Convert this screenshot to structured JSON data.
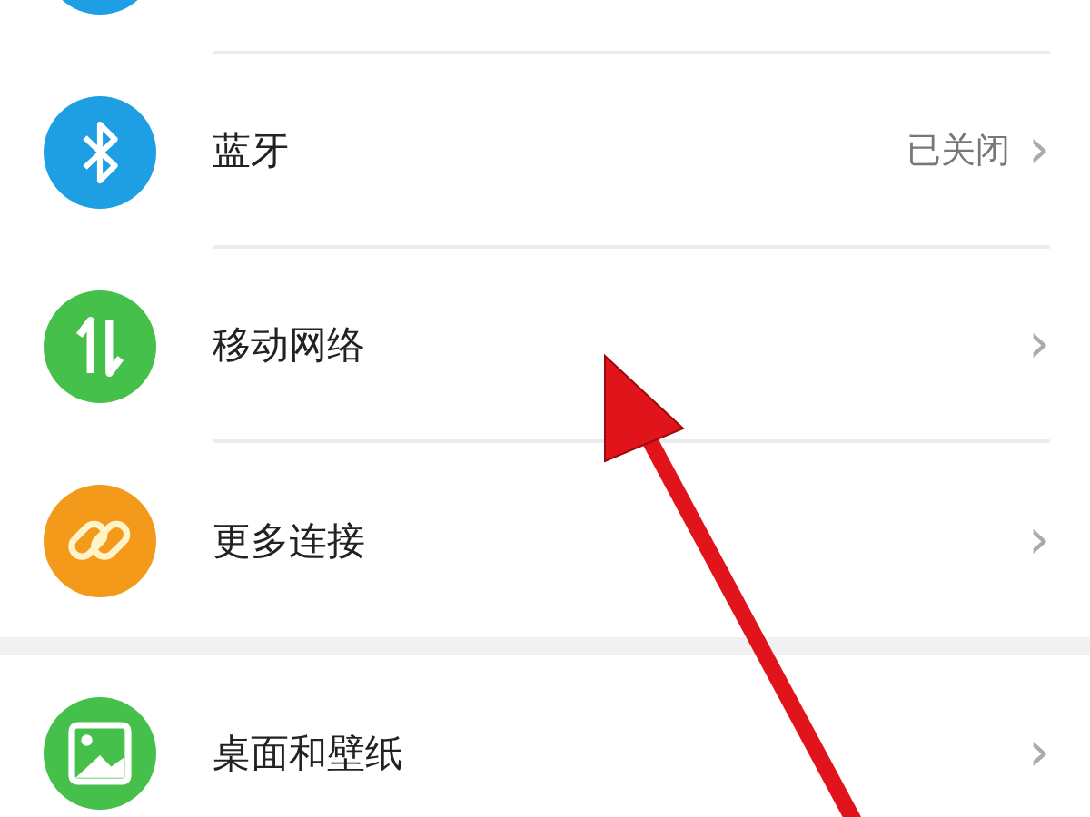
{
  "sections": [
    {
      "items": [
        {
          "kind": "cut",
          "color": "#1e9fe3"
        },
        {
          "kind": "bluetooth",
          "color": "#1e9fe3",
          "label": "蓝牙",
          "value": "已关闭",
          "chevron": "›"
        },
        {
          "kind": "data",
          "color": "#45c04a",
          "label": "移动网络",
          "chevron": "›"
        },
        {
          "kind": "link",
          "color": "#f39a1b",
          "label": "更多连接",
          "chevron": "›"
        }
      ]
    },
    {
      "items": [
        {
          "kind": "image",
          "color": "#45c04a",
          "label": "桌面和壁纸",
          "chevron": "›"
        }
      ]
    }
  ],
  "annotations": [
    {
      "kind": "arrow",
      "color": "#e0141a"
    }
  ]
}
